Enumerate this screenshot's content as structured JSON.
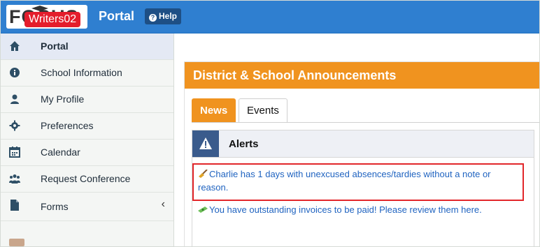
{
  "app": {
    "logo_text": "FOCUS",
    "overlay_label": "Writers02",
    "portal_title": "Portal",
    "help_label": "Help"
  },
  "sidebar": {
    "items": [
      {
        "label": "Portal",
        "icon": "home-icon"
      },
      {
        "label": "School Information",
        "icon": "info-icon"
      },
      {
        "label": "My Profile",
        "icon": "user-icon"
      },
      {
        "label": "Preferences",
        "icon": "gear-icon"
      },
      {
        "label": "Calendar",
        "icon": "calendar-icon"
      },
      {
        "label": "Request Conference",
        "icon": "users-icon"
      },
      {
        "label": "Forms",
        "icon": "file-icon"
      }
    ]
  },
  "main": {
    "panel_title": "District & School Announcements",
    "tabs": [
      "News",
      "Events"
    ],
    "alerts_title": "Alerts",
    "alerts": [
      "Charlie has 1 days with unexcused absences/tardies without a note or reason.",
      "You have outstanding invoices to be paid! Please review them here."
    ]
  },
  "colors": {
    "topbar": "#2f7fd0",
    "accent": "#f0931f",
    "highlight_border": "#e2262a",
    "link": "#1f63c0"
  }
}
